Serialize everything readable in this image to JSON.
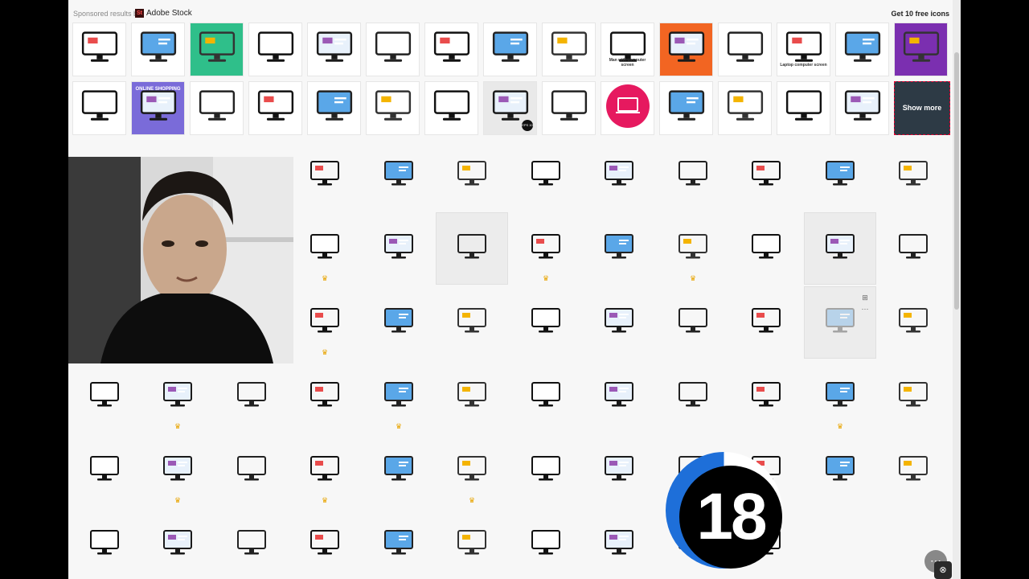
{
  "stock_bar": {
    "sponsored_label": "Sponsored results by",
    "brand_mark": "St",
    "brand_name": "Adobe Stock",
    "free_icons_link": "Get 10 free icons"
  },
  "stock_tiles_row1": [
    {
      "icon": "isometric-monitor-chart"
    },
    {
      "icon": "monitor-bookshelf"
    },
    {
      "icon": "computer-search-green"
    },
    {
      "icon": "monitor-outline"
    },
    {
      "icon": "desktop-keyboard"
    },
    {
      "icon": "widescreen-monitor"
    },
    {
      "icon": "monitor-thin"
    },
    {
      "icon": "video-call-screen"
    },
    {
      "icon": "laptop-blue"
    },
    {
      "icon": "man-with-computer",
      "caption": "Man with computer screen"
    },
    {
      "icon": "isometric-screen-orange"
    },
    {
      "icon": "devices-blue"
    },
    {
      "icon": "laptop-lock",
      "caption": "Laptop computer screen"
    },
    {
      "icon": "monitor-bold"
    },
    {
      "icon": "isometric-box-purple"
    }
  ],
  "stock_tiles_row2": [
    {
      "icon": "laptop-flat"
    },
    {
      "icon": "online-shopping",
      "caption": "ONLINE SHOPPING"
    },
    {
      "icon": "dashboard-monitor"
    },
    {
      "icon": "analytics-monitor"
    },
    {
      "icon": "cursor-monitor"
    },
    {
      "icon": "monitor-simple"
    },
    {
      "icon": "cloud-monitor"
    },
    {
      "icon": "search-computer",
      "eps": "EPS 10"
    },
    {
      "icon": "responsive-devices"
    },
    {
      "icon": "pink-circle-laptop"
    },
    {
      "icon": "devices-set"
    },
    {
      "icon": "blue-monitor"
    },
    {
      "icon": "user-chat-screen"
    },
    {
      "icon": "desktop-tower"
    }
  ],
  "show_more_label": "Show more",
  "results_count_overlay": "18",
  "hover_actions": [
    "⊞",
    "⋯"
  ],
  "crown_glyph": "♛",
  "results": [
    {
      "icon": "analytics-target"
    },
    {
      "icon": "bar-chart-monitor"
    },
    {
      "icon": "design-tools-monitor"
    },
    {
      "icon": "code-window-monitor"
    },
    {
      "icon": "selection-monitor"
    },
    {
      "icon": "click-monitor"
    },
    {
      "icon": "code-editor-monitor"
    },
    {
      "icon": "cloud-network"
    },
    {
      "icon": "code-screen-blue"
    },
    {
      "icon": "doctor-video-call",
      "premium": true
    },
    {
      "icon": "blue-gradient-monitor"
    },
    {
      "icon": "monitor-outline-gray"
    },
    {
      "icon": "wifi-monitor",
      "premium": true
    },
    {
      "icon": "dual-monitors"
    },
    {
      "icon": "web-design-blue",
      "premium": true
    },
    {
      "icon": "terminal-window"
    },
    {
      "icon": "seo-monitor"
    },
    {
      "icon": "tv-orange"
    },
    {
      "icon": "network-tree",
      "premium": true
    },
    {
      "icon": "blue-monitor-flat"
    },
    {
      "icon": "black-monitor"
    },
    {
      "icon": "tv-black"
    },
    {
      "icon": "projector-screen"
    },
    {
      "icon": "devices-outline"
    },
    {
      "icon": "webcam-lamp-monitor"
    },
    {
      "icon": "retro-tv-faded"
    },
    {
      "icon": "user-desktop"
    },
    {
      "icon": "imac"
    },
    {
      "icon": "wireless-scan-monitor",
      "premium": true
    },
    {
      "icon": "desktop-pc"
    },
    {
      "icon": "computer-tower-outline"
    },
    {
      "icon": "tv-remote",
      "premium": true
    },
    {
      "icon": "grid-dashboard"
    },
    {
      "icon": "imac-outline"
    },
    {
      "icon": "mobile-on-laptop"
    },
    {
      "icon": "flat-screen-tv"
    },
    {
      "icon": "cursor-click-monitor"
    },
    {
      "icon": "monitor-stand",
      "premium": true
    },
    {
      "icon": "video-conference"
    },
    {
      "icon": "settings-monitor"
    },
    {
      "icon": "location-monitor",
      "premium": true
    },
    {
      "icon": "growth-target"
    },
    {
      "icon": "tablet-wifi",
      "premium": true
    },
    {
      "icon": "globe-monitor"
    },
    {
      "icon": "newspaper-monitor",
      "premium": true
    },
    {
      "icon": "tv-label"
    },
    {
      "icon": "youtube-monitor"
    },
    {
      "icon": "device-mockup"
    },
    {
      "icon": "green-list-monitor"
    },
    {
      "icon": "mobile-device"
    },
    {
      "icon": "person-monitor"
    },
    {
      "icon": "monitor-blank"
    },
    {
      "icon": "id-card-monitor"
    },
    {
      "icon": "rocket-monitor"
    },
    {
      "icon": "support-monitor"
    },
    {
      "icon": "monitor-thin-2"
    },
    {
      "icon": "network-cube"
    },
    {
      "icon": "pink-screen"
    },
    {
      "icon": "monitor-bottom"
    },
    {
      "icon": "chart-box"
    },
    {
      "icon": "laptop-blue-2"
    }
  ],
  "fab_label": "⋯",
  "fab2_label": "⊗"
}
